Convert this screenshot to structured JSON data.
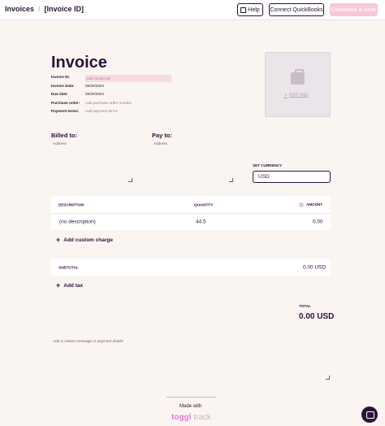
{
  "breadcrumb": {
    "root": "Invoices",
    "separator": "/",
    "current": "[Invoice ID]"
  },
  "toolbar": {
    "help_label": "Help",
    "quickbooks_label": "Connect QuickBooks",
    "download_label": "Download & save"
  },
  "invoice": {
    "title": "Invoice",
    "fields": [
      {
        "label": "Invoice ID:",
        "value": "Add invoice ID",
        "placeholder": true
      },
      {
        "label": "Invoice Date:",
        "value": "09/30/2024",
        "placeholder": false
      },
      {
        "label": "Due date:",
        "value": "09/30/2024",
        "placeholder": false
      },
      {
        "label": "Purchase order:",
        "value": "Add purchase order number",
        "placeholder": true
      },
      {
        "label": "Payment terms:",
        "value": "Add payment terms",
        "placeholder": true
      }
    ],
    "add_logo": "Add logo"
  },
  "billed_to": {
    "label": "Billed to:",
    "address_placeholder": "Address"
  },
  "pay_to": {
    "label": "Pay to:",
    "address_placeholder": "Address"
  },
  "currency": {
    "label": "SET CURRENCY",
    "value": "USD"
  },
  "table": {
    "headers": {
      "description": "DESCRIPTION",
      "quantity": "QUANTITY",
      "amount": "AMOUNT"
    },
    "rows": [
      {
        "description": "(no description)",
        "quantity": "44.5",
        "amount": "0.00"
      }
    ]
  },
  "add_custom_charge": "Add custom charge",
  "subtotal": {
    "label": "SUBTOTAL",
    "value": "0.00 USD"
  },
  "add_tax": "Add tax",
  "total": {
    "label": "TOTAL",
    "value": "0.00 USD"
  },
  "custom_message_placeholder": "Add a custom message or payment details",
  "footer": {
    "made_with": "Made with",
    "brand_main": "toggl",
    "brand_sub": " track"
  },
  "colors": {
    "accent": "#2c1338",
    "pink": "#f6c8d6",
    "background": "#fbf5f2",
    "brand": "#e57cd8"
  }
}
